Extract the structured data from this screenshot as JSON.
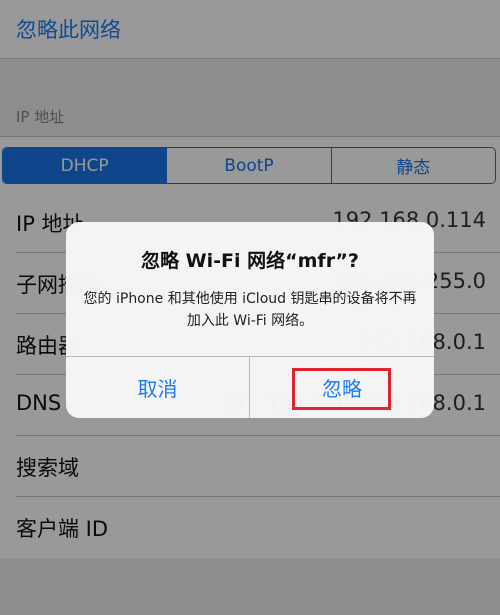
{
  "forget_network_label": "忽略此网络",
  "section_header": "IP 地址",
  "segments": [
    {
      "label": "DHCP",
      "active": true
    },
    {
      "label": "BootP",
      "active": false
    },
    {
      "label": "静态",
      "active": false
    }
  ],
  "rows": [
    {
      "label": "IP 地址",
      "value": "192.168.0.114"
    },
    {
      "label": "子网掩码",
      "value": "255.255.255.0"
    },
    {
      "label": "路由器",
      "value": "192.168.0.1"
    },
    {
      "label": "DNS",
      "value": "192.168.1.1, 192.168.0.1"
    },
    {
      "label": "搜索域",
      "value": ""
    },
    {
      "label": "客户端 ID",
      "value": ""
    }
  ],
  "alert": {
    "title": "忽略 Wi-Fi 网络“mfr”?",
    "message": "您的 iPhone 和其他使用 iCloud 钥匙串的设备将不再加入此 Wi-Fi 网络。",
    "cancel_label": "取消",
    "forget_label": "忽略"
  },
  "colors": {
    "accent": "#1a73e8",
    "highlight": "#e0242e"
  }
}
